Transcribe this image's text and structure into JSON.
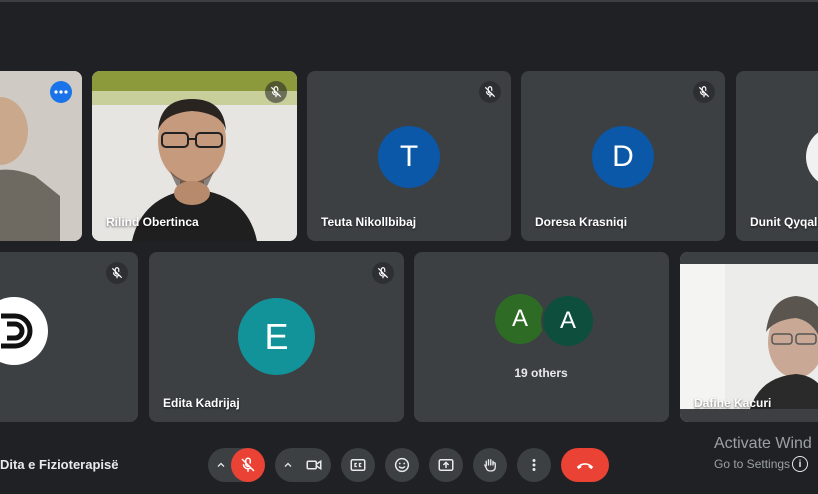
{
  "tiles": {
    "t1": {
      "name": ""
    },
    "t2": {
      "name": "Rilind Obertinca"
    },
    "t3": {
      "name": "Teuta Nikollbibaj",
      "initial": "T",
      "color": "#0b57a8"
    },
    "t4": {
      "name": "Doresa Krasniqi",
      "initial": "D",
      "color": "#0b57a8"
    },
    "t5": {
      "name": "Dunit Qyqall"
    },
    "t6": {
      "name": ""
    },
    "t7": {
      "name": "Edita Kadrijaj",
      "initial": "E",
      "color": "#12939a"
    },
    "t8": {
      "others_label": "19 others",
      "a1": "A",
      "a2": "A"
    },
    "t9": {
      "name": "Dafine Kacuri"
    }
  },
  "meeting_title": "Dita e Fizioterapisë",
  "controls": [
    "mic-off",
    "camera",
    "captions",
    "emoji",
    "present",
    "raise-hand",
    "more",
    "leave"
  ],
  "watermark": {
    "line1": "Activate Wind",
    "line2": "Go to Settings",
    "info": "i"
  }
}
